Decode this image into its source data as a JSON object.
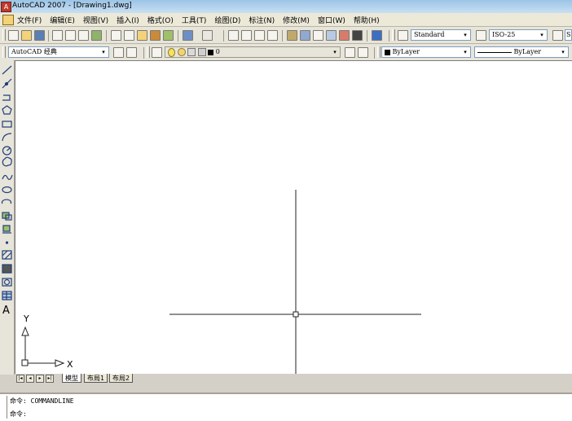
{
  "window": {
    "title": "AutoCAD 2007 - [Drawing1.dwg]"
  },
  "menu": {
    "items": [
      "文件(F)",
      "编辑(E)",
      "视图(V)",
      "插入(I)",
      "格式(O)",
      "工具(T)",
      "绘图(D)",
      "标注(N)",
      "修改(M)",
      "窗口(W)",
      "帮助(H)"
    ]
  },
  "toolbar": {
    "text_style": "Standard",
    "dim_style": "ISO-25",
    "trailing_text": "S",
    "workspace": "AutoCAD 经典",
    "layer": "0",
    "color": "ByLayer",
    "linetype": "ByLayer"
  },
  "canvas": {
    "ucs_y_label": "Y",
    "ucs_x_label": "X"
  },
  "layout_tabs": [
    "模型",
    "布局1",
    "布局2"
  ],
  "command": {
    "history": "命令: COMMANDLINE",
    "prompt": "命令:"
  }
}
